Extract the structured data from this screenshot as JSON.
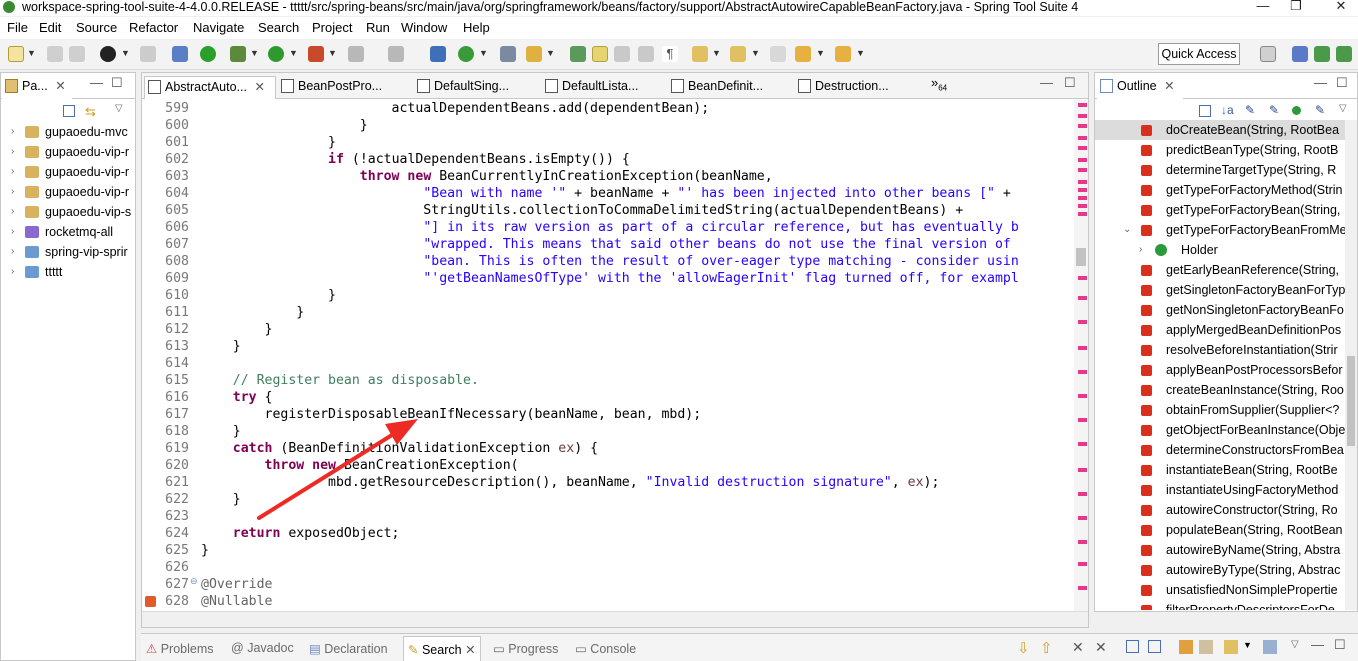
{
  "window": {
    "title": "workspace-spring-tool-suite-4-4.0.0.RELEASE - ttttt/src/spring-beans/src/main/java/org/springframework/beans/factory/support/AbstractAutowireCapableBeanFactory.java - Spring Tool Suite 4",
    "minimize": "—",
    "restore": "❐",
    "close": "✕"
  },
  "menu": [
    "File",
    "Edit",
    "Source",
    "Refactor",
    "Navigate",
    "Search",
    "Project",
    "Run",
    "Window",
    "Help"
  ],
  "toolbar": {
    "quick_access": "Quick Access"
  },
  "left": {
    "tab_label": "Pa...",
    "items": [
      "gupaoedu-mvc",
      "gupaoedu-vip-r",
      "gupaoedu-vip-r",
      "gupaoedu-vip-r",
      "gupaoedu-vip-s",
      "rocketmq-all",
      "spring-vip-sprir",
      "ttttt"
    ]
  },
  "editor": {
    "tabs": [
      "AbstractAuto...",
      "BeanPostPro...",
      "DefaultSing...",
      "DefaultLista...",
      "BeanDefinit...",
      "Destruction..."
    ],
    "overflow": "»",
    "overflow_count": "64",
    "lines": [
      {
        "n": "599",
        "html": "                        actualDependentBeans.add(dependentBean);"
      },
      {
        "n": "600",
        "html": "                    }"
      },
      {
        "n": "601",
        "html": "                }"
      },
      {
        "n": "602",
        "html": "                <kw>if</kw> (!actualDependentBeans.isEmpty()) {"
      },
      {
        "n": "603",
        "html": "                    <kw>throw new</kw> BeanCurrentlyInCreationException(beanName,"
      },
      {
        "n": "604",
        "html": "                            <str>\"Bean with name '\"</str> + beanName + <str>\"' has been injected into other beans [\"</str> +"
      },
      {
        "n": "605",
        "html": "                            StringUtils.collectionToCommaDelimitedString(actualDependentBeans) +"
      },
      {
        "n": "606",
        "html": "                            <str>\"] in its raw version as part of a circular reference, but has eventually b</str>"
      },
      {
        "n": "607",
        "html": "                            <str>\"wrapped. This means that said other beans do not use the final version of</str>"
      },
      {
        "n": "608",
        "html": "                            <str>\"bean. This is often the result of over-eager type matching - consider usin</str>"
      },
      {
        "n": "609",
        "html": "                            <str>\"'getBeanNamesOfType' with the 'allowEagerInit' flag turned off, for exampl</str>"
      },
      {
        "n": "610",
        "html": "                }"
      },
      {
        "n": "611",
        "html": "            }"
      },
      {
        "n": "612",
        "html": "        }"
      },
      {
        "n": "613",
        "html": "    }"
      },
      {
        "n": "614",
        "html": ""
      },
      {
        "n": "615",
        "html": "    <cmt>// Register bean as disposable.</cmt>"
      },
      {
        "n": "616",
        "html": "    <kw>try</kw> {"
      },
      {
        "n": "617",
        "html": "        registerDisposableBeanIfNecessary(beanName, bean, mbd);"
      },
      {
        "n": "618",
        "html": "    }"
      },
      {
        "n": "619",
        "html": "    <kw>catch</kw> (BeanDefinitionValidationException <var>ex</var>) {"
      },
      {
        "n": "620",
        "html": "        <kw>throw new</kw> BeanCreationException("
      },
      {
        "n": "621",
        "html": "                mbd.getResourceDescription(), beanName, <str>\"Invalid destruction signature\"</str>, <var>ex</var>);"
      },
      {
        "n": "622",
        "html": "    }"
      },
      {
        "n": "623",
        "html": ""
      },
      {
        "n": "624",
        "html": "    <kw>return</kw> exposedObject;"
      },
      {
        "n": "625",
        "html": "}"
      },
      {
        "n": "626",
        "html": ""
      },
      {
        "n": "627",
        "html": "<ann>@Override</ann>"
      },
      {
        "n": "628",
        "html": "<ann>@Nullable</ann>"
      }
    ]
  },
  "outline": {
    "tab_label": "Outline",
    "items": [
      "doCreateBean(String, RootBea",
      "predictBeanType(String, RootB",
      "determineTargetType(String, R",
      "getTypeForFactoryMethod(Strin",
      "getTypeForFactoryBean(String,",
      "getTypeForFactoryBeanFromMe",
      "Holder",
      "getEarlyBeanReference(String,",
      "getSingletonFactoryBeanForTyp",
      "getNonSingletonFactoryBeanFo",
      "applyMergedBeanDefinitionPos",
      "resolveBeforeInstantiation(Strir",
      "applyBeanPostProcessorsBefor",
      "createBeanInstance(String, Roo",
      "obtainFromSupplier(Supplier<?",
      "getObjectForBeanInstance(Obje",
      "determineConstructorsFromBea",
      "instantiateBean(String, RootBe",
      "instantiateUsingFactoryMethod",
      "autowireConstructor(String, Ro",
      "populateBean(String, RootBean",
      "autowireByName(String, Abstra",
      "autowireByType(String, Abstrac",
      "unsatisfiedNonSimplePropertie",
      "filterPropertyDescriptorsForDe"
    ]
  },
  "bottom": {
    "tabs": [
      "Problems",
      "Javadoc",
      "Declaration",
      "Search",
      "Progress",
      "Console"
    ]
  }
}
